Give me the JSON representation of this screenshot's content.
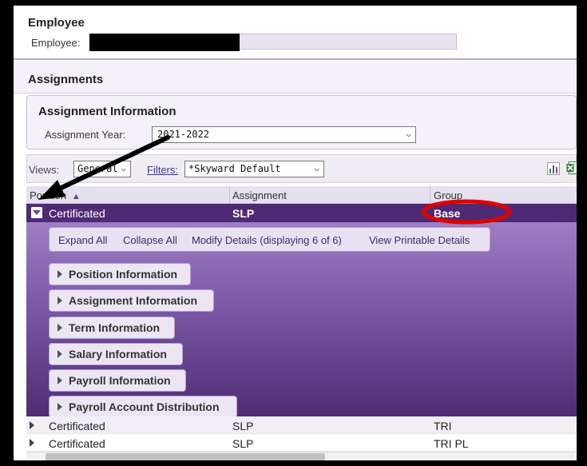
{
  "employee": {
    "title": "Employee",
    "label": "Employee:"
  },
  "assignments": {
    "title": "Assignments"
  },
  "assignment_info": {
    "title": "Assignment Information",
    "year_label": "Assignment Year:",
    "year_value": "2021-2022"
  },
  "views": {
    "label": "Views:",
    "value": "General",
    "filters_label": "Filters:",
    "filters_value": "*Skyward Default"
  },
  "grid": {
    "columns": [
      "Position",
      "Assignment",
      "Group"
    ],
    "sort_indicator": "▲",
    "selected_row": {
      "position": "Certificated",
      "assignment": "SLP",
      "group": "Base"
    },
    "rows": [
      {
        "position": "Certificated",
        "assignment": "SLP",
        "group": "TRI"
      },
      {
        "position": "Certificated",
        "assignment": "SLP",
        "group": "TRI PL"
      }
    ]
  },
  "detail": {
    "actions": [
      "Expand All",
      "Collapse All",
      "Modify Details (displaying 6 of 6)",
      "View Printable Details"
    ],
    "sections": [
      "Position Information",
      "Assignment Information",
      "Term Information",
      "Salary Information",
      "Payroll Information",
      "Payroll Account Distribution"
    ]
  },
  "icons": {
    "chart": "bar-chart-icon",
    "excel": "excel-export-icon",
    "annotation_color": "#e00000"
  }
}
